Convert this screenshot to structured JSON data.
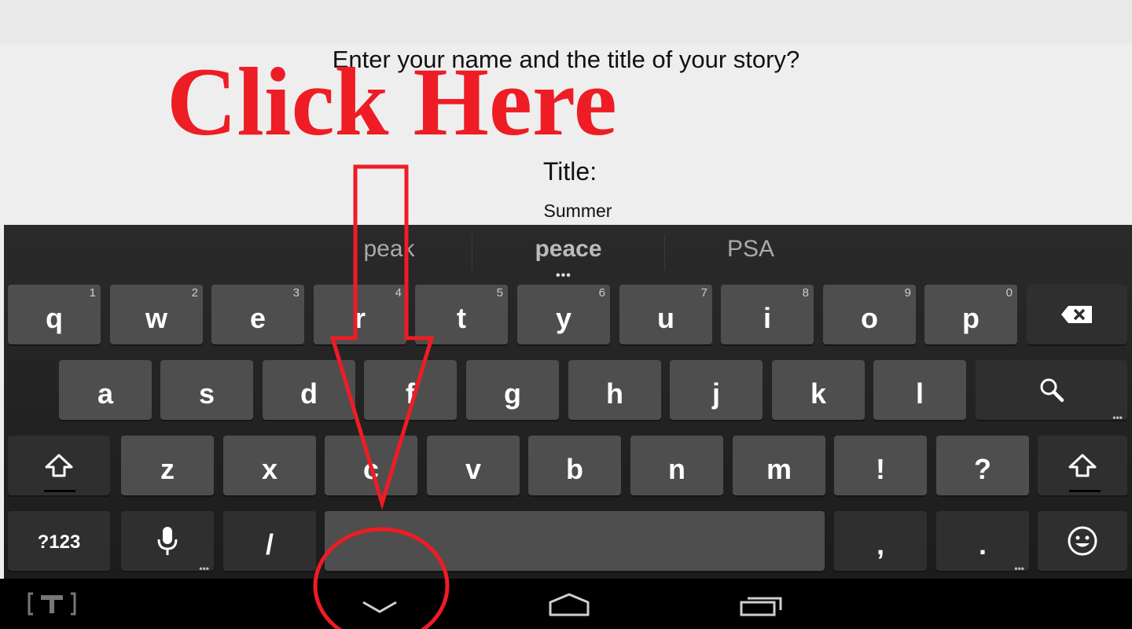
{
  "app": {
    "question": "Enter your name and the title of your story?",
    "title_label": "Title:",
    "title_value": "Summer"
  },
  "suggestions": [
    {
      "text": "peak"
    },
    {
      "text": "peace"
    },
    {
      "text": "PSA"
    }
  ],
  "keyboard": {
    "row1": [
      {
        "label": "q",
        "hint": "1"
      },
      {
        "label": "w",
        "hint": "2"
      },
      {
        "label": "e",
        "hint": "3"
      },
      {
        "label": "r",
        "hint": "4"
      },
      {
        "label": "t",
        "hint": "5"
      },
      {
        "label": "y",
        "hint": "6"
      },
      {
        "label": "u",
        "hint": "7"
      },
      {
        "label": "i",
        "hint": "8"
      },
      {
        "label": "o",
        "hint": "9"
      },
      {
        "label": "p",
        "hint": "0"
      }
    ],
    "row2": [
      "a",
      "s",
      "d",
      "f",
      "g",
      "h",
      "j",
      "k",
      "l"
    ],
    "row3": [
      "z",
      "x",
      "c",
      "v",
      "b",
      "n",
      "m",
      "!",
      "?"
    ],
    "symbols_label": "?123",
    "slash_label": "/",
    "comma_label": ",",
    "period_label": "."
  },
  "overlay": {
    "callout_text": "Click Here",
    "color": "#ee1c25"
  },
  "icons": [
    "backspace-icon",
    "search-icon",
    "shift-icon",
    "mic-icon",
    "emoji-icon",
    "back-down-icon",
    "home-icon",
    "recent-apps-icon",
    "keyboard-status-icon"
  ]
}
